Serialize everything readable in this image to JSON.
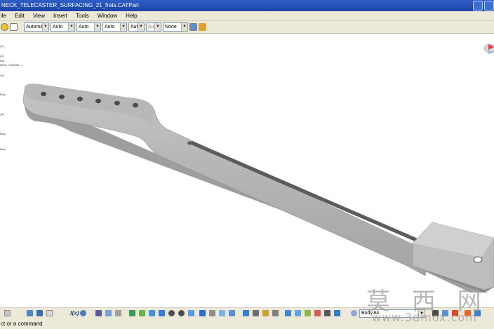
{
  "window": {
    "title": "NECK_TELECASTER_SURFACING_21_frets.CATPart"
  },
  "menu": {
    "items": [
      "ile",
      "Edit",
      "View",
      "Insert",
      "Tools",
      "Window",
      "Help"
    ]
  },
  "properties_toolbar": {
    "combos": [
      {
        "value": "Automa",
        "enabled": true
      },
      {
        "value": "Auto",
        "enabled": true
      },
      {
        "value": "Auto",
        "enabled": true
      },
      {
        "value": "Auto",
        "enabled": true
      },
      {
        "value": "Aut",
        "enabled": true
      },
      {
        "value": "Aut",
        "enabled": false
      },
      {
        "value": "None",
        "enabled": true
      }
    ]
  },
  "spec_tree": {
    "nodes": [
      "y.1)",
      "y.1)",
      "ell.6",
      "NECK_CHANNEL_1",
      "y.9)",
      "Body",
      "y.1)",
      "Body",
      "Body"
    ]
  },
  "bottom_toolbar": {
    "fx_label": "f(x)",
    "body_combo": "Body.84"
  },
  "status": {
    "prompt": "ct or a command"
  },
  "watermark": {
    "chinese": "莫 西 网",
    "url": "www.3dmox.com"
  },
  "colors": {
    "titlebar": "#1c43a6",
    "toolbar_bg": "#ece9d8",
    "part_fill": "#a9a9a9",
    "part_shadow": "#7f7f7f",
    "viewport_bg": "#ffffff"
  }
}
